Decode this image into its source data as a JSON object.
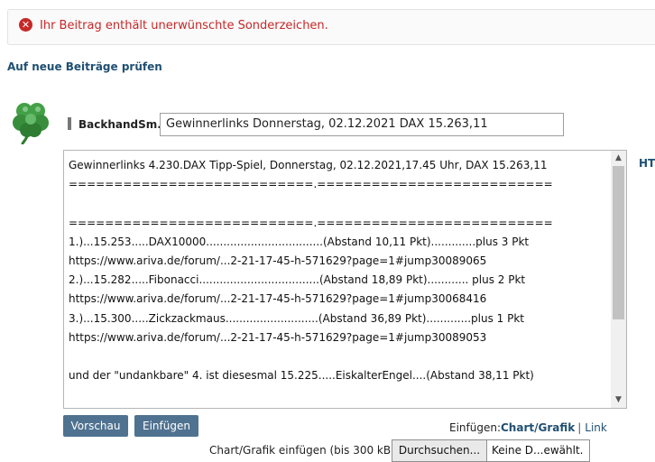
{
  "error": {
    "message": "Ihr Beitrag enthält unerwünschte Sonderzeichen.",
    "icon": "error-x-icon",
    "color": "#c62828"
  },
  "check_new_posts_link": "Auf neue Beiträge prüfen",
  "avatar": {
    "icon": "four-leaf-clover-icon"
  },
  "author_label": "BackhandSm.:",
  "title_input": {
    "value": "Gewinnerlinks Donnerstag, 02.12.2021 DAX 15.263,11"
  },
  "message_body": {
    "lines": [
      "Gewinnerlinks 4.230.DAX Tipp-Spiel, Donnerstag, 02.12.2021,17.45 Uhr, DAX 15.263,11",
      "===========================.==========================",
      "",
      "===========================.==========================",
      "1.)...15.253.....DAX10000..................................(Abstand 10,11 Pkt).............plus 3 Pkt",
      "https://www.ariva.de/forum/...2-21-17-45-h-571629?page=1#jump30089065",
      "2.)...15.282.....Fibonacci...................................(Abstand 18,89 Pkt)............ plus 2 Pkt",
      "https://www.ariva.de/forum/...2-21-17-45-h-571629?page=1#jump30068416",
      "3.)...15.300.....Zickzackmaus...........................(Abstand 36,89 Pkt).............plus 1 Pkt",
      "https://www.ariva.de/forum/...2-21-17-45-h-571629?page=1#jump30089053",
      "",
      "und der \"undankbare\" 4. ist diesesmal 15.225.....EiskalterEngel....(Abstand 38,11 Pkt)"
    ]
  },
  "side_label": "HT",
  "buttons": {
    "preview": "Vorschau",
    "insert": "Einfügen"
  },
  "insert_options": {
    "label": "Einfügen:",
    "chart": "Chart/Grafik",
    "separator": "|",
    "link": "Link"
  },
  "upload": {
    "label": "Chart/Grafik einfügen (bis 300 kB):",
    "browse": "Durchsuchen...",
    "file_status": "Keine D...ewählt."
  },
  "colors": {
    "button_bg": "#4f7290",
    "link": "#1f4f73",
    "error": "#c62828"
  }
}
